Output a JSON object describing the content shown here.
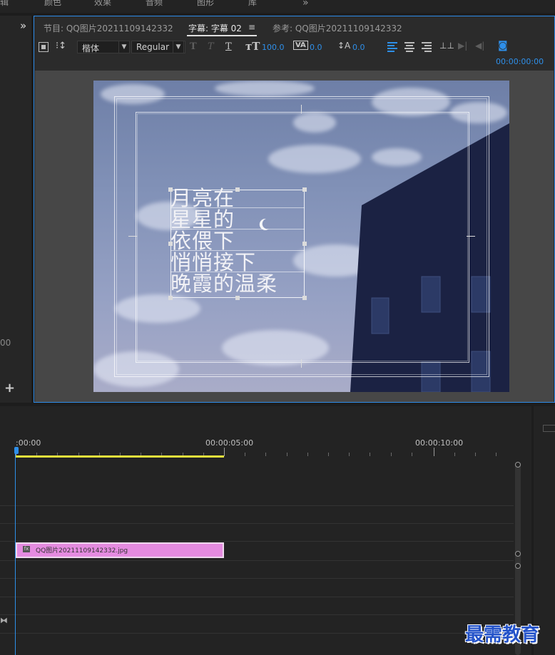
{
  "workspace_menu": [
    "辑",
    "颜色",
    "效果",
    "音频",
    "图形",
    "库"
  ],
  "overflow_symbol": "»",
  "left_panel": {
    "value": "00",
    "add_symbol": "+"
  },
  "title_panel": {
    "collapse_symbol": "»",
    "tabs": [
      {
        "label": "节目: QQ图片20211109142332",
        "active": false
      },
      {
        "label": "字幕: 字幕 02",
        "active": true
      },
      {
        "label": "参考: QQ图片20211109142332",
        "active": false
      }
    ],
    "tab_menu_symbol": "≡",
    "toolbar": {
      "font_family": "楷体",
      "font_style": "Regular",
      "bold_label": "T",
      "italic_label": "T",
      "underline_label": "T",
      "font_size": "100.0",
      "kerning": "0.0",
      "leading": "0.0",
      "timecode": "00:00:00:00"
    },
    "lyrics": [
      "月亮在",
      "星星的",
      "依偎下",
      "悄悄接下",
      "晚霞的温柔"
    ],
    "colors": {
      "accent": "#2e8fe9",
      "panel": "#2b2b2b",
      "building": "#1b2243"
    }
  },
  "timeline": {
    "timecodes": [
      ":00:00",
      "00:00:05:00",
      "00:00:10:00"
    ],
    "clip_label": "QQ图片20211109142332.jpg",
    "clip_fx": "fx",
    "clip_color": "#e58be0",
    "work_area_color": "#e7e23c"
  },
  "watermark": "最需教育"
}
